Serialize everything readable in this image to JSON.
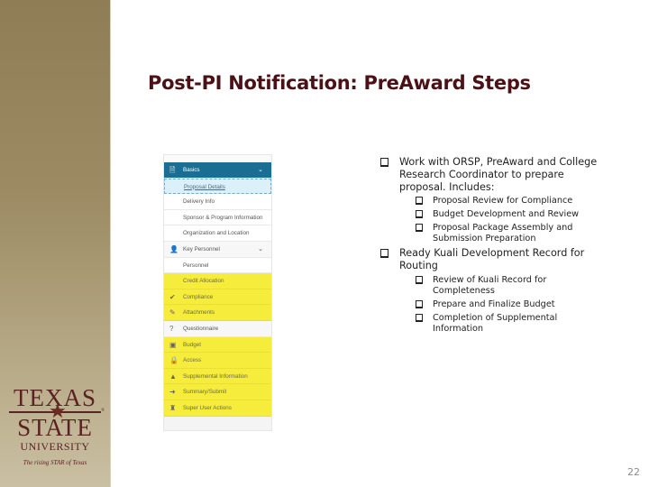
{
  "slide": {
    "title": "Post-PI Notification: PreAward Steps",
    "page_number": "22"
  },
  "logo": {
    "line1": "TEXAS",
    "star": "★",
    "line2": "STATE",
    "trademark": "®",
    "line3": "UNIVERSITY",
    "tagline": "The rising STAR of Texas"
  },
  "nav": {
    "items": [
      {
        "label": "Basics",
        "icon": "file-icon",
        "icon_glyph": "🗎",
        "type": "active-section",
        "chevron": "⌄"
      },
      {
        "label": "Proposal Details",
        "type": "current"
      },
      {
        "label": "Delivery Info",
        "type": "sub"
      },
      {
        "label": "Sponsor & Program Information",
        "type": "sub"
      },
      {
        "label": "Organization and Location",
        "type": "sub"
      },
      {
        "label": "Key Personnel",
        "icon": "person-icon",
        "icon_glyph": "👤",
        "type": "section",
        "chevron": "⌄"
      },
      {
        "label": "Personnel",
        "type": "sub"
      },
      {
        "label": "Credit Allocation",
        "type": "hl"
      },
      {
        "label": "Compliance",
        "icon": "checkmark-icon",
        "icon_glyph": "✔",
        "type": "hl-section"
      },
      {
        "label": "Attachments",
        "icon": "paperclip-icon",
        "icon_glyph": "✎",
        "type": "hl-section"
      },
      {
        "label": "Questionnaire",
        "icon": "question-circle-icon",
        "icon_glyph": "?",
        "type": "section"
      },
      {
        "label": "Budget",
        "icon": "money-icon",
        "icon_glyph": "▣",
        "type": "hl-section"
      },
      {
        "label": "Access",
        "icon": "lock-icon",
        "icon_glyph": "🔒",
        "type": "hl-section"
      },
      {
        "label": "Supplemental Information",
        "icon": "tree-icon",
        "icon_glyph": "▲",
        "type": "hl-section"
      },
      {
        "label": "Summary/Submit",
        "icon": "arrow-right-icon",
        "icon_glyph": "➜",
        "type": "hl-section"
      },
      {
        "label": "Super User Actions",
        "icon": "sitemap-icon",
        "icon_glyph": "♜",
        "type": "hl-section"
      }
    ]
  },
  "bullets": [
    {
      "text": "Work with ORSP, PreAward and College Research Coordinator to prepare proposal. Includes:",
      "children": [
        "Proposal Review for Compliance",
        "Budget Development and Review",
        "Proposal Package Assembly and Submission Preparation"
      ]
    },
    {
      "text": "Ready Kuali Development Record for Routing",
      "children": [
        "Review of Kuali Record for Completeness",
        "Prepare and Finalize Budget",
        "Completion of Supplemental Information"
      ]
    }
  ],
  "colors": {
    "title": "#4a1216",
    "band": "#9c8b63",
    "nav_active": "#1b6e93",
    "highlight": "#f6ec3c"
  }
}
